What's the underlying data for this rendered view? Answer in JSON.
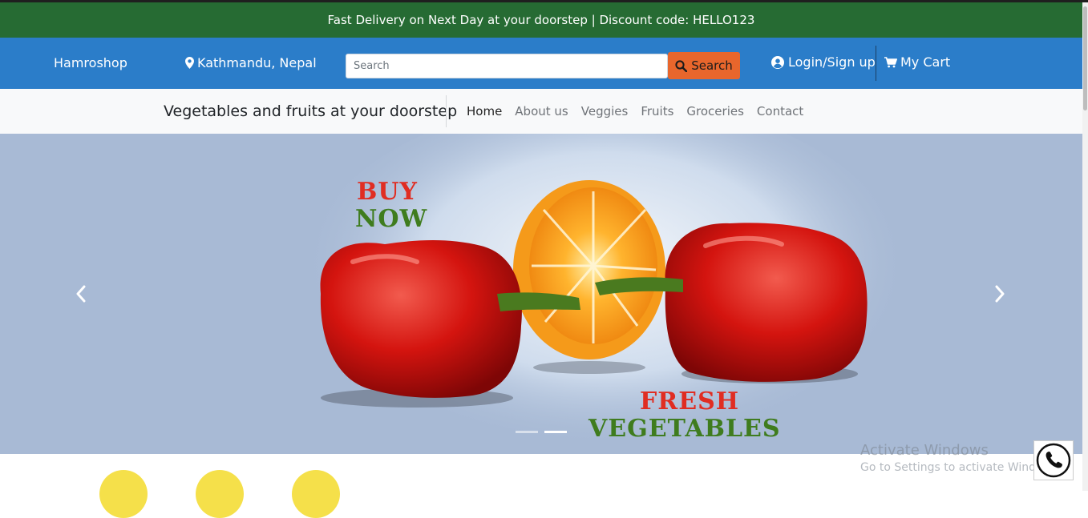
{
  "announcement": "Fast Delivery on Next Day at your doorstep | Discount code: HELLO123",
  "header": {
    "brand": "Hamroshop",
    "location": "Kathmandu, Nepal",
    "search_placeholder": "Search",
    "search_button": "Search",
    "login": "Login/Sign up",
    "cart": "My Cart"
  },
  "subnav": {
    "tagline": "Vegetables and fruits at your doorstep",
    "links": [
      "Home",
      "About us",
      "Veggies",
      "Fruits",
      "Groceries",
      "Contact"
    ],
    "active": "Home"
  },
  "hero": {
    "line1": "BUY",
    "line2": "NOW",
    "line3": "FRESH",
    "line4": "VEGETABLES",
    "slide_count": 2,
    "active_slide": 2
  },
  "windows_watermark": {
    "title": "Activate Windows",
    "subtitle": "Go to Settings to activate Windows."
  },
  "colors": {
    "announcement_bg": "#266b33",
    "header_bg": "#2b7dc9",
    "search_button_bg": "#e8662c",
    "hero_bg": "#a8bad5"
  },
  "icons": {
    "location": "map-marker-icon",
    "search": "search-icon",
    "login": "user-circle-icon",
    "cart": "shopping-cart-icon",
    "prev": "chevron-left-icon",
    "next": "chevron-right-icon",
    "call": "phone-icon"
  }
}
